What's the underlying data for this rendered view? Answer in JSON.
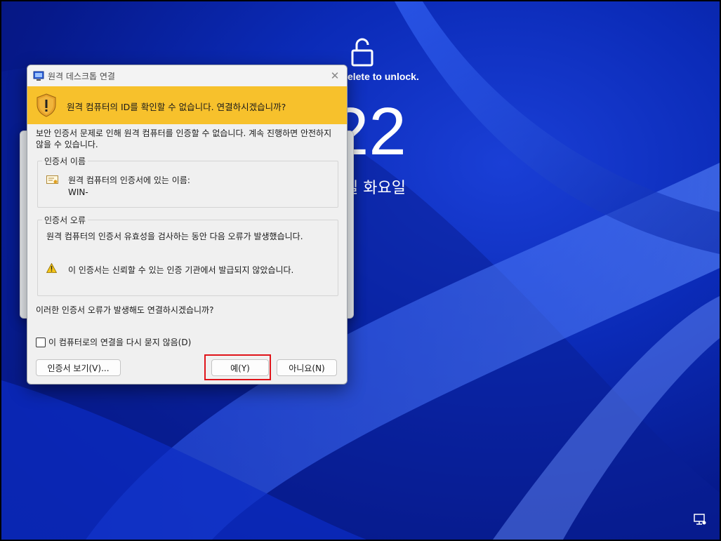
{
  "lock_screen": {
    "hint": "t+Delete to unlock.",
    "time": "22",
    "date": "일 화요일"
  },
  "dialog": {
    "title": "원격 데스크톱 연결",
    "close_label": "✕",
    "banner_text": "원격 컴퓨터의 ID를 확인할 수 없습니다. 연결하시겠습니까?",
    "intro_text": "보안 인증서 문제로 인해 원격 컴퓨터를 인증할 수 없습니다. 계속 진행하면 안전하지 않을 수 있습니다.",
    "cert_name_group": {
      "legend": "인증서 이름",
      "label": "원격 컴퓨터의 인증서에 있는 이름:",
      "value": "WIN-"
    },
    "cert_error_group": {
      "legend": "인증서 오류",
      "text": "원격 컴퓨터의 인증서 유효성을 검사하는 동안 다음 오류가 발생했습니다.",
      "warning": "이 인증서는 신뢰할 수 있는 인증 기관에서 발급되지 않았습니다."
    },
    "question": "이러한 인증서 오류가 발생해도 연결하시겠습니까?",
    "checkbox_label": "이 컴퓨터로의 연결을 다시 묻지 않음(D)",
    "checkbox_checked": false,
    "buttons": {
      "view_cert": "인증서 보기(V)...",
      "yes": "예(Y)",
      "no": "아니요(N)"
    }
  },
  "colors": {
    "banner": "#f7c12c",
    "highlight": "#e0141a",
    "wallpaper": "#0b2bb8"
  }
}
